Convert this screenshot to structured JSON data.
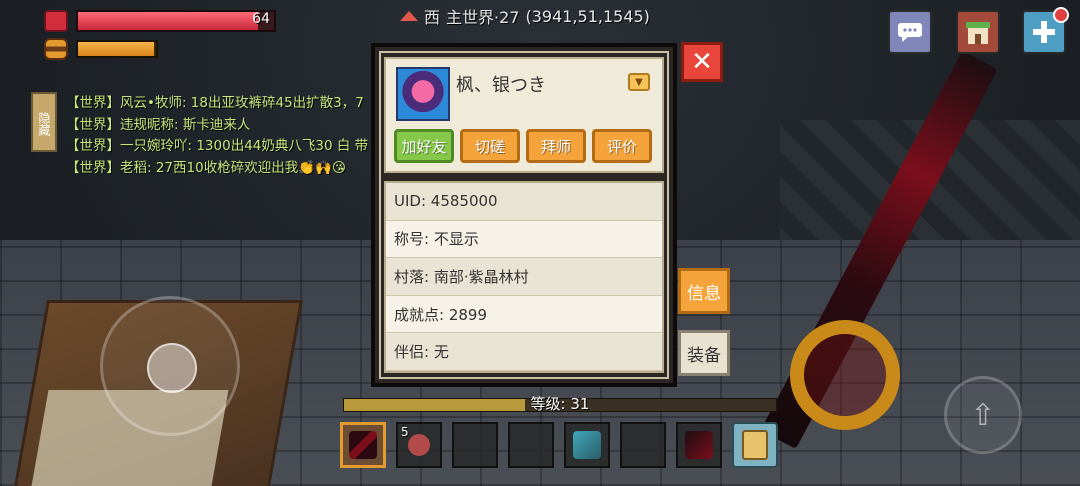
{
  "hud": {
    "hp_value": "64",
    "hp_fraction": 0.92,
    "food_fraction": 0.98,
    "location_direction": "西",
    "location_world": "主世界·27",
    "location_coords": "(3941,51,1545)"
  },
  "top_buttons": {
    "chat_icon": "chat-bubble-icon",
    "shop_icon": "shop-icon",
    "add_icon": "plus-icon"
  },
  "chat": {
    "hide_label": "隐藏",
    "lines": [
      "【世界】风云•牧师:  18出亚玫裤碎45出扩散3，7",
      "【世界】违规昵称:  斯卡迪来人",
      "【世界】一只婉玲吖:  1300出44奶典八飞30 白 带",
      "【世界】老稻:  27西10收枪碎欢迎出我👏🙌😘"
    ]
  },
  "profile": {
    "name": "枫、银つき",
    "buttons": {
      "add_friend": "加好友",
      "duel": "切磋",
      "apprentice": "拜师",
      "rate": "评价"
    },
    "info": [
      "UID: 4585000",
      "称号: 不显示",
      "村落: 南部·紫晶林村",
      "成就点: 2899",
      "伴侣: 无"
    ]
  },
  "side_tabs": {
    "info": "信息",
    "equipment": "装备"
  },
  "level": {
    "label": "等级: 31",
    "progress": 0.42
  },
  "hotbar": {
    "slot2_count": "5"
  },
  "colors": {
    "accent_orange": "#f5a43b",
    "accent_green": "#86c94a",
    "close_red": "#e8463b",
    "chat_green": "#c7e87a"
  }
}
